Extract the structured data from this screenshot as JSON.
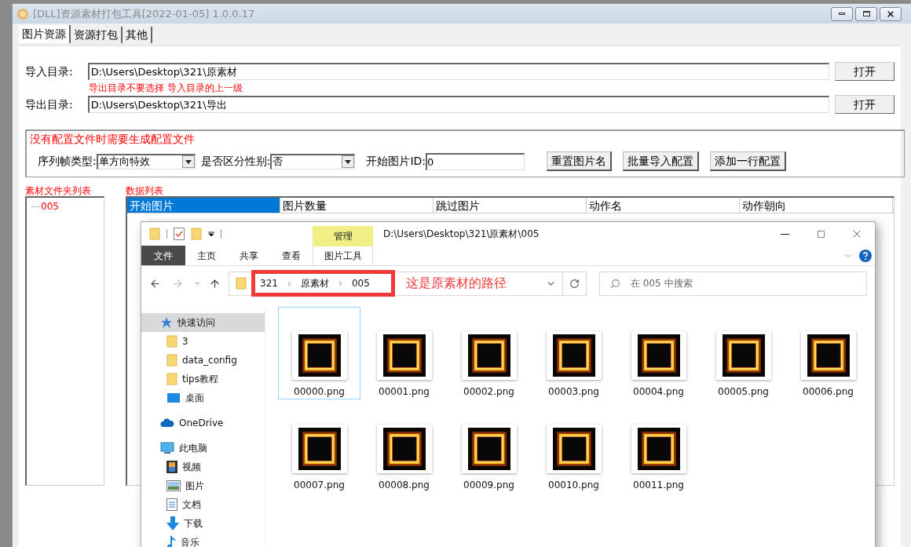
{
  "window": {
    "title": "[DLL]资源素材打包工具[2022-01-05] 1.0.0.17"
  },
  "tabs": [
    {
      "label": "图片资源",
      "selected": true
    },
    {
      "label": "资源打包",
      "selected": false
    },
    {
      "label": "其他",
      "selected": false
    }
  ],
  "import_dir": {
    "label": "导入目录:",
    "value": "D:\\Users\\Desktop\\321\\原素材",
    "button": "打开"
  },
  "hint": "导出目录不要选择 导入目录的上一级",
  "export_dir": {
    "label": "导出目录:",
    "value": "D:\\Users\\Desktop\\321\\导出",
    "button": "打开"
  },
  "config": {
    "title": "没有配置文件时需要生成配置文件",
    "frame_type": {
      "label": "序列帧类型:",
      "value": "单方向特效"
    },
    "gender": {
      "label": "是否区分性别:",
      "value": "否"
    },
    "start_id": {
      "label": "开始图片ID:",
      "value": "0"
    },
    "buttons": [
      "重置图片名",
      "批量导入配置",
      "添加一行配置"
    ]
  },
  "folder_list": {
    "title": "素材文件夹列表",
    "items": [
      "005"
    ]
  },
  "data_list": {
    "title": "数据列表",
    "columns": [
      {
        "label": "开始图片",
        "selected": true
      },
      {
        "label": "图片数量",
        "selected": false
      },
      {
        "label": "跳过图片",
        "selected": false
      },
      {
        "label": "动作名",
        "selected": false
      },
      {
        "label": "动作朝向",
        "selected": false
      }
    ]
  },
  "explorer": {
    "title": "D:\\Users\\Desktop\\321\\原素材\\005",
    "context_label": "管理",
    "ribbon_tabs": [
      {
        "label": "文件",
        "kind": "file"
      },
      {
        "label": "主页",
        "kind": "tab"
      },
      {
        "label": "共享",
        "kind": "tab"
      },
      {
        "label": "查看",
        "kind": "tab"
      },
      {
        "label": "图片工具",
        "kind": "context"
      }
    ],
    "breadcrumb": [
      "321",
      "原素材",
      "005"
    ],
    "annotation": "这是原素材的路径",
    "search": {
      "placeholder": "在 005 中搜索"
    },
    "nav": [
      {
        "label": "快速访问",
        "kind": "star",
        "selected": true,
        "children": [
          {
            "label": "3",
            "kind": "folder",
            "selected": false
          },
          {
            "label": "data_config",
            "kind": "folder",
            "selected": false
          },
          {
            "label": "tips教程",
            "kind": "folder",
            "selected": false
          },
          {
            "label": "桌面",
            "kind": "desktop",
            "selected": false
          }
        ]
      },
      {
        "label": "OneDrive",
        "kind": "cloud",
        "selected": false
      },
      {
        "label": "此电脑",
        "kind": "pc",
        "selected": false,
        "children": [
          {
            "label": "视频",
            "kind": "video",
            "selected": false
          },
          {
            "label": "图片",
            "kind": "pictures",
            "selected": false
          },
          {
            "label": "文档",
            "kind": "documents",
            "selected": false
          },
          {
            "label": "下载",
            "kind": "downloads",
            "selected": false
          },
          {
            "label": "音乐",
            "kind": "music",
            "selected": false
          }
        ]
      }
    ],
    "files": [
      {
        "name": "00000.png",
        "selected": true
      },
      {
        "name": "00001.png",
        "selected": false
      },
      {
        "name": "00002.png",
        "selected": false
      },
      {
        "name": "00003.png",
        "selected": false
      },
      {
        "name": "00004.png",
        "selected": false
      },
      {
        "name": "00005.png",
        "selected": false
      },
      {
        "name": "00006.png",
        "selected": false
      },
      {
        "name": "00007.png",
        "selected": false
      },
      {
        "name": "00008.png",
        "selected": false
      },
      {
        "name": "00009.png",
        "selected": false
      },
      {
        "name": "00010.png",
        "selected": false
      },
      {
        "name": "00011.png",
        "selected": false
      }
    ]
  }
}
